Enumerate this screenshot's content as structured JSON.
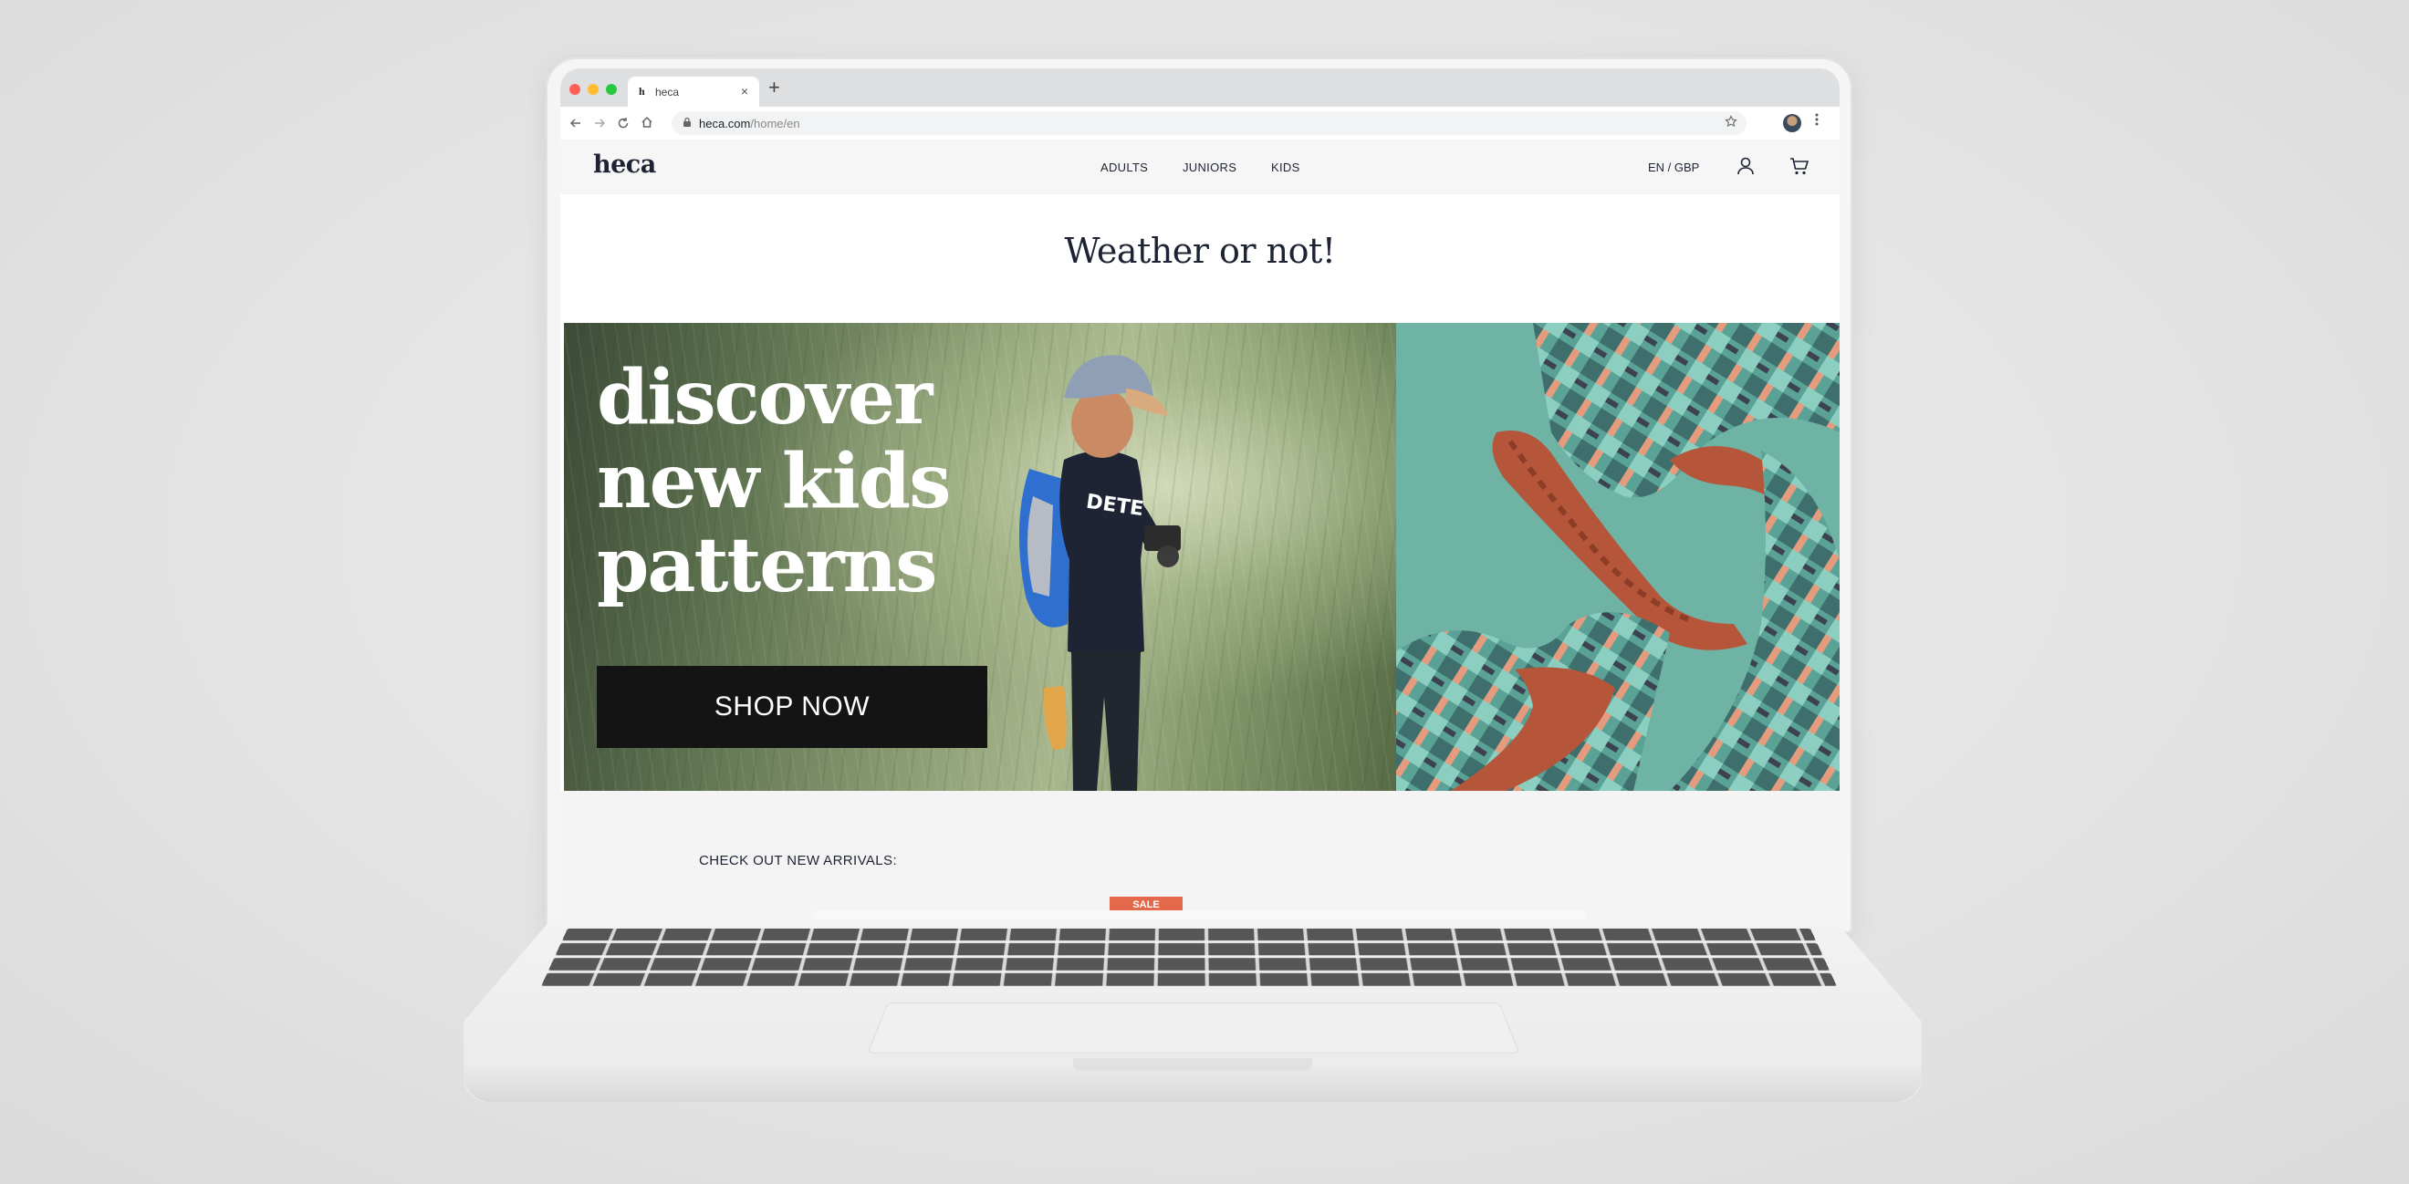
{
  "browser": {
    "tab_title": "heca",
    "tab_favicon": "h",
    "close_glyph": "×",
    "new_tab_glyph": "+",
    "url_domain": "heca.com",
    "url_path": "/home/en",
    "traffic_lights": [
      "#ff5f57",
      "#febc2e",
      "#28c840"
    ]
  },
  "site": {
    "logo": "heca",
    "nav": [
      "ADULTS",
      "JUNIORS",
      "KIDS"
    ],
    "locale": "EN / GBP",
    "headline": "Weather or not!",
    "hero": {
      "title_line1": "discover",
      "title_line2": "new kids",
      "title_line3": "patterns",
      "cta": "SHOP NOW",
      "shirt_text": "DETE"
    },
    "arrivals_label": "CHECK OUT NEW ARRIVALS:",
    "sale_badge": "SALE"
  },
  "colors": {
    "brand_text": "#1d2333",
    "cta_bg": "#141414",
    "sale": "#e4694a",
    "boot_sole": "#b5553a",
    "boot_bg": "#6fb3a5"
  }
}
